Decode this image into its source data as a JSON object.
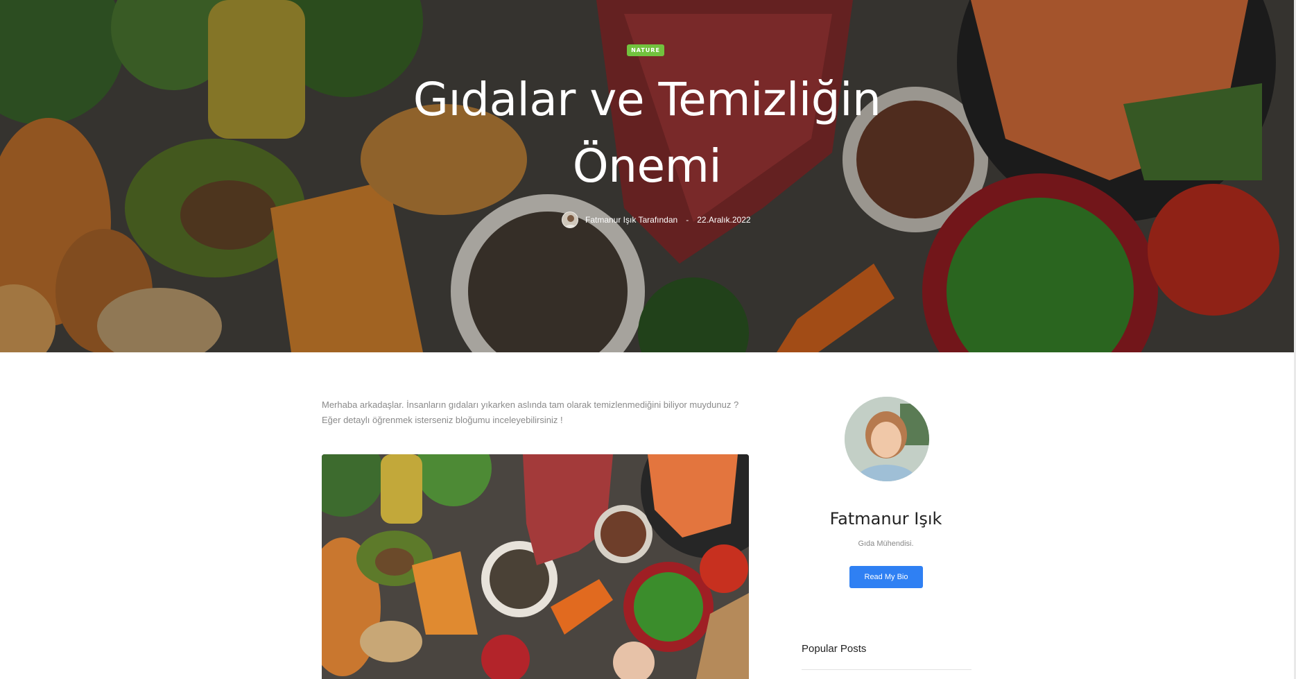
{
  "hero": {
    "category": "NATURE",
    "title": "Gıdalar ve Temizliğin Önemi",
    "author_line": "Fatmanur Işık Tarafından",
    "separator": "-",
    "date": "22.Aralık.2022"
  },
  "article": {
    "intro_line_1": "Merhaba arkadaşlar. İnsanların gıdaları yıkarken aslında tam olarak temizlenmediğini biliyor muydunuz ?",
    "intro_line_2": "Eğer detaylı öğrenmek isterseniz bloğumu inceleyebilirsiniz !"
  },
  "sidebar": {
    "author_name": "Fatmanur Işık",
    "author_role": "Gıda Mühendisi.",
    "bio_button": "Read My Bio",
    "popular_title": "Popular Posts"
  },
  "colors": {
    "badge": "#72c23e",
    "button": "#2f80f3"
  }
}
